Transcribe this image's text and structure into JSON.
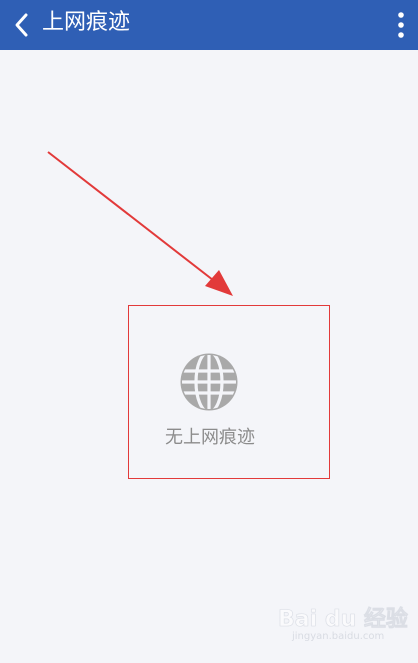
{
  "header": {
    "title": "上网痕迹"
  },
  "empty_state": {
    "message": "无上网痕迹"
  },
  "watermark": {
    "brand": "Bai du 经验",
    "url": "jingyan.baidu.com"
  },
  "icons": {
    "back": "chevron-left-icon",
    "menu": "more-vertical-icon",
    "globe": "globe-icon"
  },
  "colors": {
    "header_bg": "#2f5fb5",
    "background": "#f4f5f9",
    "annotation_red": "#e23a3a",
    "empty_text": "#8c8c8c"
  }
}
